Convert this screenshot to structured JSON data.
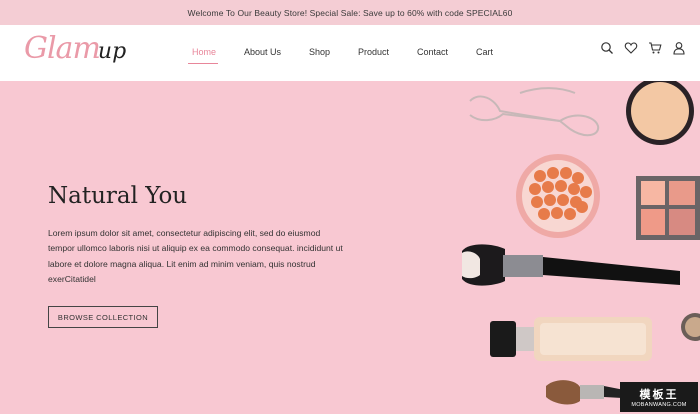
{
  "announcement": "Welcome To Our Beauty Store! Special Sale: Save up to 60% with code SPECIAL60",
  "logo": {
    "part1": "Glam",
    "part2": "up"
  },
  "nav": {
    "items": [
      {
        "label": "Home"
      },
      {
        "label": "About Us"
      },
      {
        "label": "Shop"
      },
      {
        "label": "Product"
      },
      {
        "label": "Contact"
      },
      {
        "label": "Cart"
      }
    ],
    "active": "Home"
  },
  "header_icons": [
    "search-icon",
    "heart-icon",
    "cart-icon",
    "user-icon"
  ],
  "hero": {
    "title": "Natural You",
    "body": "Lorem ipsum dolor sit amet, consectetur adipiscing elit, sed do eiusmod tempor ullomco laboris nisi ut aliquip ex ea commodo consequat. incididunt ut labore et dolore magna aliqua. Lit enim ad minim veniam, quis nostrud exerCitatidel",
    "button": "BROWSE COLLECTION"
  },
  "watermark": {
    "line1": "模板王",
    "line2": "MOBANWANG.COM"
  },
  "colors": {
    "topbar": "#f4cdd4",
    "hero": "#f8c8d2",
    "accent": "#e8869a"
  }
}
